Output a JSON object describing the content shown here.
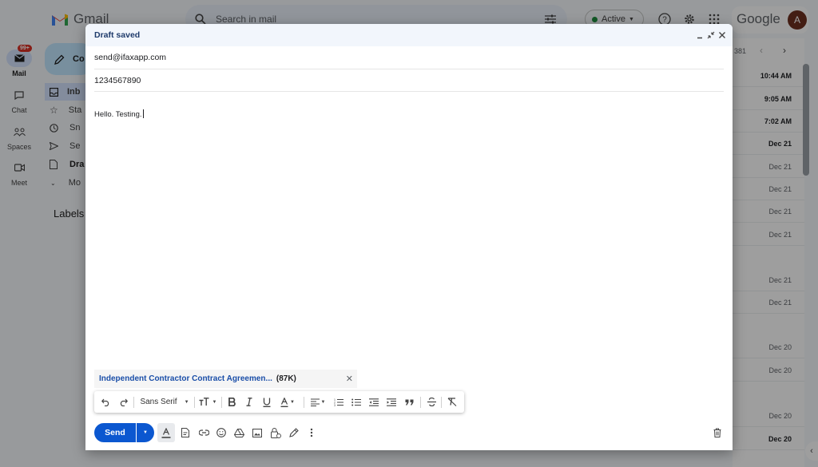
{
  "gmail": {
    "product_name": "Gmail",
    "search_placeholder": "Search in mail",
    "status": "Active",
    "google_label": "Google",
    "avatar_initial": "A",
    "mail_badge": "99+",
    "rail": [
      {
        "label": "Mail"
      },
      {
        "label": "Chat"
      },
      {
        "label": "Spaces"
      },
      {
        "label": "Meet"
      }
    ],
    "compose_label": "Co",
    "nav_items": [
      "Inb",
      "Sta",
      "Sn",
      "Se",
      "Dra",
      "Mo"
    ],
    "labels_heading": "Labels",
    "pagination_fragment": "381",
    "list_times": [
      {
        "time": "10:44 AM",
        "bold": true
      },
      {
        "time": "9:05 AM",
        "bold": true
      },
      {
        "time": "7:02 AM",
        "bold": true
      },
      {
        "time": "Dec 21",
        "bold": true
      },
      {
        "time": "Dec 21",
        "bold": false
      },
      {
        "time": "Dec 21",
        "bold": false
      },
      {
        "time": "Dec 21",
        "bold": false
      },
      {
        "time": "Dec 21",
        "bold": false
      },
      {
        "time": "Dec 21",
        "bold": false
      },
      {
        "time": "Dec 21",
        "bold": false
      },
      {
        "time": "Dec 20",
        "bold": false
      },
      {
        "time": "Dec 20",
        "bold": false
      },
      {
        "time": "Dec 20",
        "bold": false
      },
      {
        "time": "Dec 20",
        "bold": true
      }
    ]
  },
  "compose": {
    "title": "Draft saved",
    "to": "send@ifaxapp.com",
    "subject": "1234567890",
    "body": "Hello. Testing.",
    "attachment": {
      "name": "Independent Contractor Contract Agreemen...",
      "size": "(87K)"
    },
    "toolbar": {
      "font": "Sans Serif"
    },
    "send_label": "Send"
  },
  "colors": {
    "accent": "#0b57d0",
    "status_green": "#1e8e3e",
    "badge_red": "#d93025"
  }
}
